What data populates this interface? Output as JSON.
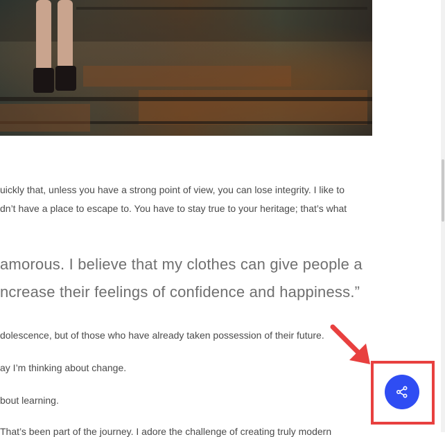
{
  "hero": {
    "alt": "Fashion photo of model standing on rusted industrial machinery"
  },
  "article": {
    "para1_line1": "uickly that, unless you have a strong point of view, you can lose integrity. I like to",
    "para1_line2": "dn’t have a place to escape to. You have to stay true to your heritage; that’s what",
    "quote_line1": "amorous. I believe that my clothes can give people a",
    "quote_line2": "ncrease their feelings of confidence and happiness.”",
    "para2": "dolescence, but of those who have already taken possession of their future.",
    "para3": "ay I’m thinking about change.",
    "para4": "bout learning.",
    "para5": "That’s been part of the journey. I adore the challenge of creating truly modern"
  },
  "share": {
    "icon": "share-icon"
  },
  "annotation": {
    "highlight_color": "#e8403f",
    "button_color": "#2f4df3"
  }
}
